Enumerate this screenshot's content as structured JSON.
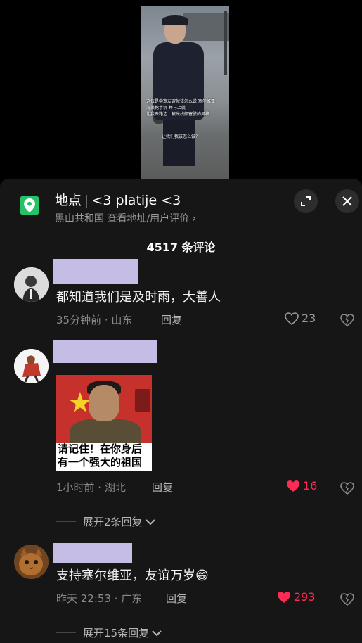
{
  "video": {
    "caption_line1": "这位是中塞友谊就该怎么说 塞尔维亚海关抢手机 并马上就",
    "caption_line2": "让我去路边上被光线般塞驶的风格",
    "caption_line3": "让我们我该怎么做?"
  },
  "location": {
    "label": "地点",
    "name": "<3 platije <3",
    "subtitle": "黑山共和国 查看地址/用户评价",
    "chevron": "›"
  },
  "comment_count": "4517 条评论",
  "comments": [
    {
      "text": "都知道我们是及时雨，大善人",
      "time_location": "35分钟前 · 山东",
      "reply_label": "回复",
      "likes": "23",
      "liked": false
    },
    {
      "meme_text_line1": "请记住！在你身后",
      "meme_text_line2": "有一个强大的祖国",
      "time_location": "1小时前 · 湖北",
      "reply_label": "回复",
      "likes": "16",
      "liked": true,
      "expand_label": "展开2条回复"
    },
    {
      "text": "支持塞尔维亚，友谊万岁",
      "emoji": "😁",
      "time_location": "昨天 22:53 · 广东",
      "reply_label": "回复",
      "likes": "293",
      "liked": true,
      "expand_label": "展开15条回复"
    }
  ],
  "colors": {
    "like_active": "#fe2c55",
    "panel_bg": "#161616",
    "name_placeholder": "#c6bde6",
    "location_pin": "#26c267"
  }
}
